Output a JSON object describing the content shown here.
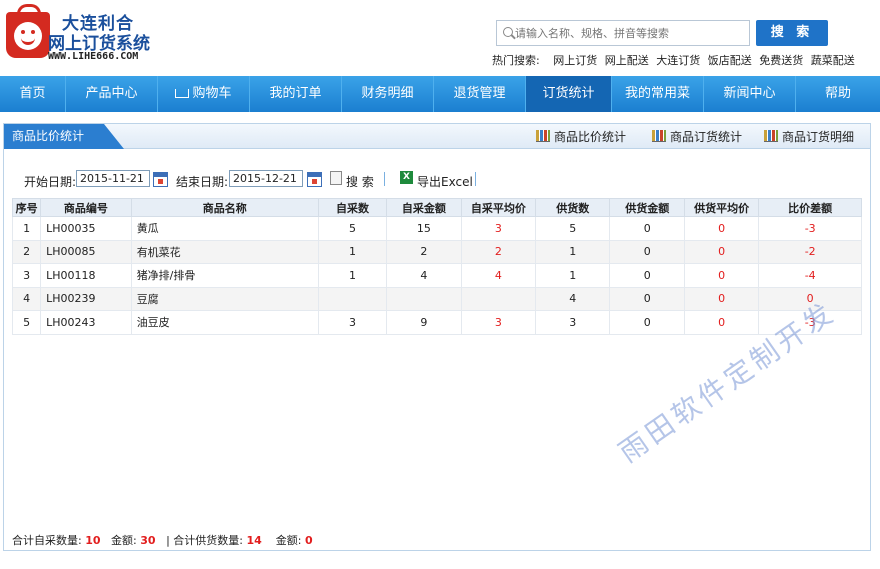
{
  "header": {
    "logo_line1": "大连利合",
    "logo_line2": "网上订货系统",
    "logo_url": "WWW.LIHE666.COM",
    "search_placeholder": "请输入名称、规格、拼音等搜索",
    "search_button": "搜 索",
    "hot_label": "热门搜索:",
    "hot_terms": [
      "网上订货",
      "网上配送",
      "大连订货",
      "饭店配送",
      "免费送货",
      "蔬菜配送"
    ]
  },
  "nav": {
    "items": [
      "首页",
      "产品中心",
      "购物车",
      "我的订单",
      "财务明细",
      "退货管理",
      "订货统计",
      "我的常用菜",
      "新闻中心",
      "帮助"
    ],
    "active": "订货统计"
  },
  "panel": {
    "title": "商品比价统计",
    "links": [
      "商品比价统计",
      "商品订货统计",
      "商品订货明细"
    ]
  },
  "filter": {
    "start_label": "开始日期:",
    "start_value": "2015-11-21",
    "end_label": "结束日期:",
    "end_value": "2015-12-21",
    "search_label": "搜 索",
    "export_label": "导出Excel"
  },
  "table": {
    "headers": [
      "序号",
      "商品编号",
      "商品名称",
      "自采数",
      "自采金额",
      "自采平均价",
      "供货数",
      "供货金额",
      "供货平均价",
      "比价差额"
    ],
    "rows": [
      [
        "1",
        "LH00035",
        "黄瓜",
        "5",
        "15",
        "3",
        "5",
        "0",
        "0",
        "-3"
      ],
      [
        "2",
        "LH00085",
        "有机菜花",
        "1",
        "2",
        "2",
        "1",
        "0",
        "0",
        "-2"
      ],
      [
        "3",
        "LH00118",
        "猪净排/排骨",
        "1",
        "4",
        "4",
        "1",
        "0",
        "0",
        "-4"
      ],
      [
        "4",
        "LH00239",
        "豆腐",
        "",
        "",
        "",
        "4",
        "0",
        "0",
        "0"
      ],
      [
        "5",
        "LH00243",
        "油豆皮",
        "3",
        "9",
        "3",
        "3",
        "0",
        "0",
        "-3"
      ]
    ]
  },
  "summary": {
    "self_qty_label": "合计自采数量:",
    "self_qty": "10",
    "self_amount_label": "金额:",
    "self_amount": "30",
    "supply_qty_label": "| 合计供货数量:",
    "supply_qty": "14",
    "supply_amount_label": "金额:",
    "supply_amount": "0"
  },
  "watermark": "雨田软件定制开发",
  "colors": {
    "nav_bg": "#1b7fd0",
    "accent_red": "#e21d1d",
    "brand_blue": "#1a4f9c"
  }
}
